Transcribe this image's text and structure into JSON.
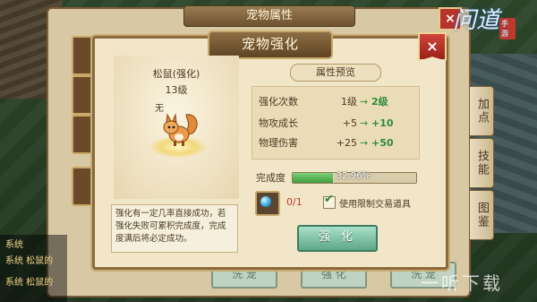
{
  "back_panel": {
    "title": "宠物属性",
    "close_label": "×",
    "chat_line1": "系统",
    "chat_line2": "系统 松鼠的",
    "chat_line3": "系统 松鼠的",
    "buttons": [
      "洗 宠",
      "强 化",
      "洗 宠"
    ]
  },
  "logo": {
    "text": "问道",
    "subtext": "手游"
  },
  "right_tabs": [
    "加点",
    "技能",
    "图鉴"
  ],
  "dialog": {
    "title": "宠物强化",
    "close_label": "×",
    "pet": {
      "name": "松鼠(强化)",
      "level": "13级",
      "status": "无"
    },
    "description": "强化有一定几率直接成功，若强化失败可累积完成度，完成度满后将必定成功。",
    "preview_header": "属性预览",
    "attributes": [
      {
        "label": "强化次数",
        "from": "1级",
        "arrow": "→",
        "to": "2级"
      },
      {
        "label": "物攻成长",
        "from": "+5",
        "arrow": "→",
        "to": "+10"
      },
      {
        "label": "物理伤害",
        "from": "+25",
        "arrow": "→",
        "to": "+50"
      }
    ],
    "progress": {
      "label": "完成度",
      "text": "32.96%",
      "value": 0.3296
    },
    "item": {
      "count": "0/1",
      "checkbox_label": "使用限制交易道具",
      "checked": true,
      "check_mark": "✔"
    },
    "strengthen_button": "强 化"
  },
  "watermark": "一听下载",
  "colors": {
    "accent_green": "#2f8a3a",
    "frame_brown": "#8a6a3c",
    "button_teal": "#5ea888"
  }
}
